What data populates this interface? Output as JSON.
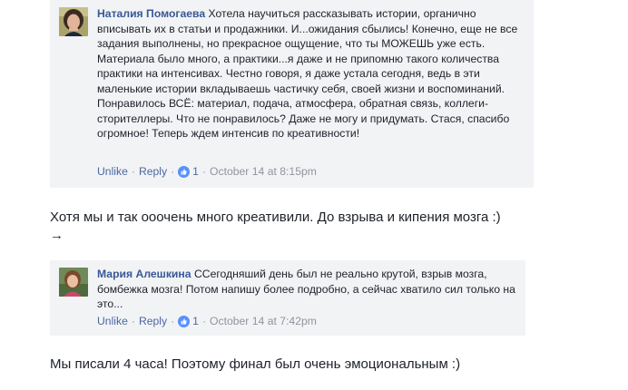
{
  "comments": [
    {
      "author": "Наталия Помогаева",
      "text": "Хотела научиться рассказывать истории, органично вписывать их в статьи и продажники. И...ожидания сбылись! Конечно, еще не все задания выполнены, но прекрасное ощущение, что ты МОЖЕШЬ уже есть. Материала было много, а практики...я даже и не припомню такого количества практики на интенсивах. Честно говоря, я даже устала сегодня, ведь в эти маленькие истории вкладываешь частичку себя, своей жизни и воспоминаний. Понравилось ВСЁ: материал, подача, атмосфера, обратная связь, коллеги-сторителлеры. Что не понравилось? Даже не могу и придумать. Стася, спасибо огромное! Теперь ждем интенсив по креативности!",
      "unlike_label": "Unlike",
      "reply_label": "Reply",
      "like_count": "1",
      "timestamp": "October 14 at 8:15pm"
    },
    {
      "author": "Мария Алешкина",
      "text": "ССегодняший день был не реально крутой, взрыв мозга, бомбежка мозга! Потом напишу более подробно, а сейчас хватило сил только на это...",
      "unlike_label": "Unlike",
      "reply_label": "Reply",
      "like_count": "1",
      "timestamp": "October 14 at 7:42pm"
    }
  ],
  "post": {
    "text_1": "Хотя мы и так ооочень много креативили. До взрыва и кипения мозга :)",
    "arrow": "→",
    "text_2": "Мы писали 4 часа! Поэтому финал был очень эмоциональным :)"
  },
  "colors": {
    "comment_bg": "#f2f3f5",
    "author": "#385898",
    "link": "#4b67a1",
    "meta": "#90949c",
    "like_blue": "#5890ff"
  },
  "icons": {
    "avatar_1": "avatar-woman-dark-hair",
    "avatar_2": "avatar-woman-outdoor",
    "like": "like-thumb-icon"
  }
}
